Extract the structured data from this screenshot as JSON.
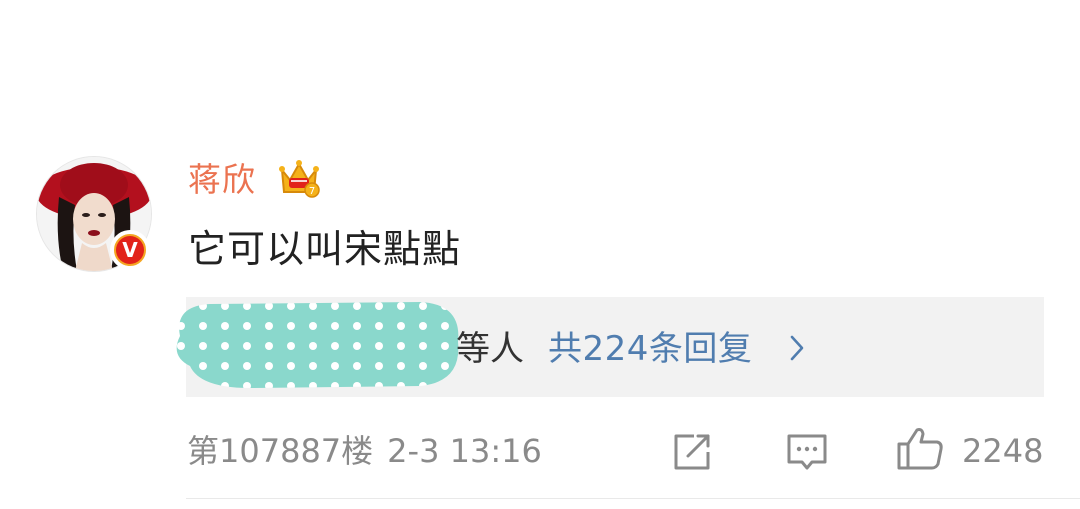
{
  "comment": {
    "username": "蒋欣",
    "text": "它可以叫宋點點",
    "reply_others_suffix": "等人",
    "reply_count_text": "共224条回复",
    "floor": "第107887楼",
    "time": "2-3 13:16",
    "like_count": "2248"
  },
  "icons": {
    "crown": "crown-level-icon",
    "verified": "verified-v-icon",
    "reply_chevron": "chevron-right-icon",
    "share": "share-icon",
    "comment": "comment-icon",
    "like": "thumbs-up-icon"
  },
  "colors": {
    "username": "#eb7350",
    "reply_link": "#507daf",
    "meta_gray": "#8a8a8a",
    "reply_box_bg": "#f2f2f2",
    "redaction_teal": "#8ad8cc"
  }
}
